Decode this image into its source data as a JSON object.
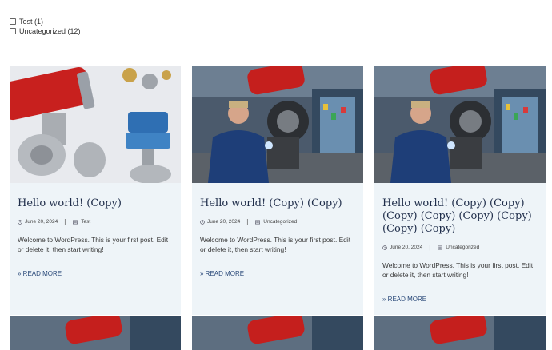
{
  "filters": [
    {
      "label": "Test (1)"
    },
    {
      "label": "Uncategorized (12)"
    }
  ],
  "posts": [
    {
      "title": "Hello world! (Copy)",
      "date": "June 20, 2024",
      "category": "Test",
      "excerpt": "Welcome to WordPress. This is your first post. Edit or delete it, then start writing!",
      "read_more": "» READ MORE",
      "image": "valves-photo"
    },
    {
      "title": "Hello world! (Copy) (Copy)",
      "date": "June 20, 2024",
      "category": "Uncategorized",
      "excerpt": "Welcome to WordPress. This is your first post. Edit or delete it, then start writing!",
      "read_more": "» READ MORE",
      "image": "engineer-photo"
    },
    {
      "title": "Hello world! (Copy) (Copy) (Copy) (Copy) (Copy) (Copy) (Copy) (Copy)",
      "date": "June 20, 2024",
      "category": "Uncategorized",
      "excerpt": "Welcome to WordPress. This is your first post. Edit or delete it, then start writing!",
      "read_more": "» READ MORE",
      "image": "engineer-photo"
    }
  ],
  "colors": {
    "card_bg": "#eef4f8",
    "title": "#1f2d4a",
    "link": "#2b4a7a"
  }
}
